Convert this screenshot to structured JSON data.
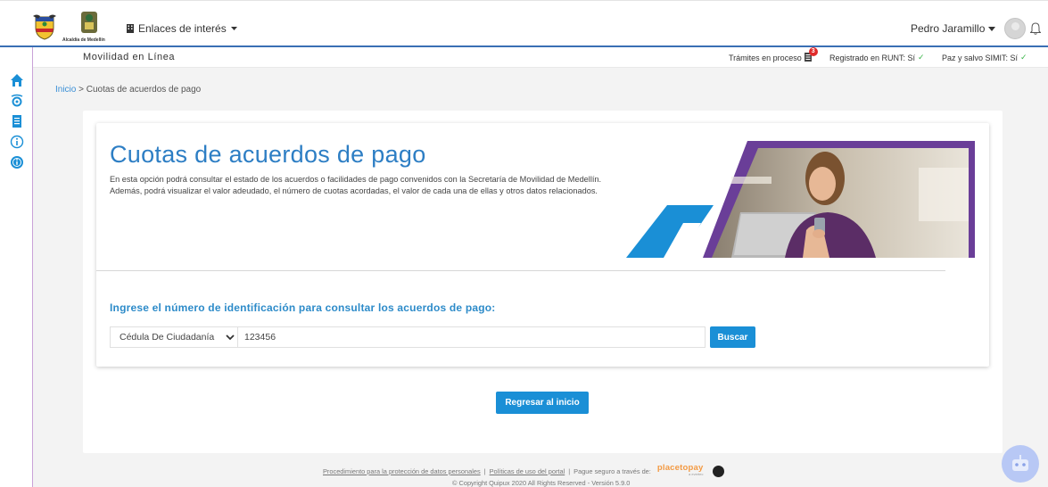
{
  "header": {
    "alcaldia_logo_text": "Alcaldía de Medellín",
    "enlaces_label": "Enlaces de interés",
    "user_name": "Pedro Jaramillo"
  },
  "subheader": {
    "title": "Movilidad en Línea",
    "tramites_label": "Trámites en proceso",
    "tramites_count": "3",
    "runt_label": "Registrado en RUNT: Sí",
    "simit_label": "Paz y salvo SIMIT: Sí"
  },
  "breadcrumb": {
    "home": "Inicio",
    "separator": ">",
    "current": "Cuotas de acuerdos de pago"
  },
  "page": {
    "title": "Cuotas de acuerdos de pago",
    "description": "En esta opción podrá consultar el estado de los acuerdos o facilidades de pago convenidos con la Secretaría de Movilidad de Medellín. Además, podrá visualizar el valor adeudado, el número de cuotas acordadas, el valor de cada una de ellas y otros datos relacionados."
  },
  "query": {
    "label": "Ingrese el número de identificación para consultar los acuerdos de pago:",
    "doc_type_selected": "Cédula De Ciudadanía",
    "id_value": "123456",
    "search_button": "Buscar"
  },
  "back_button": "Regresar al inicio",
  "footer": {
    "link_privacy": "Procedimiento para la protección de datos personales",
    "sep1": "|",
    "link_policies": "Políticas de uso del portal",
    "sep2": "|",
    "pay_text": "Pague seguro a través de:",
    "placetopay_brand": "placetopay",
    "placetopay_sub": "a evertec",
    "copyright": "© Copyright Quipux 2020 All Rights Reserved - Versión 5.9.0"
  },
  "colors": {
    "primary": "#1a8fd6",
    "title_blue": "#2d7ec4",
    "accent_purple": "#6a3e98",
    "header_line": "#3a6fb4",
    "check_green": "#3bb54a"
  },
  "icons": {
    "sidebar": [
      "home-icon",
      "gear-icon",
      "document-icon",
      "info-icon",
      "info-filled-icon"
    ]
  }
}
